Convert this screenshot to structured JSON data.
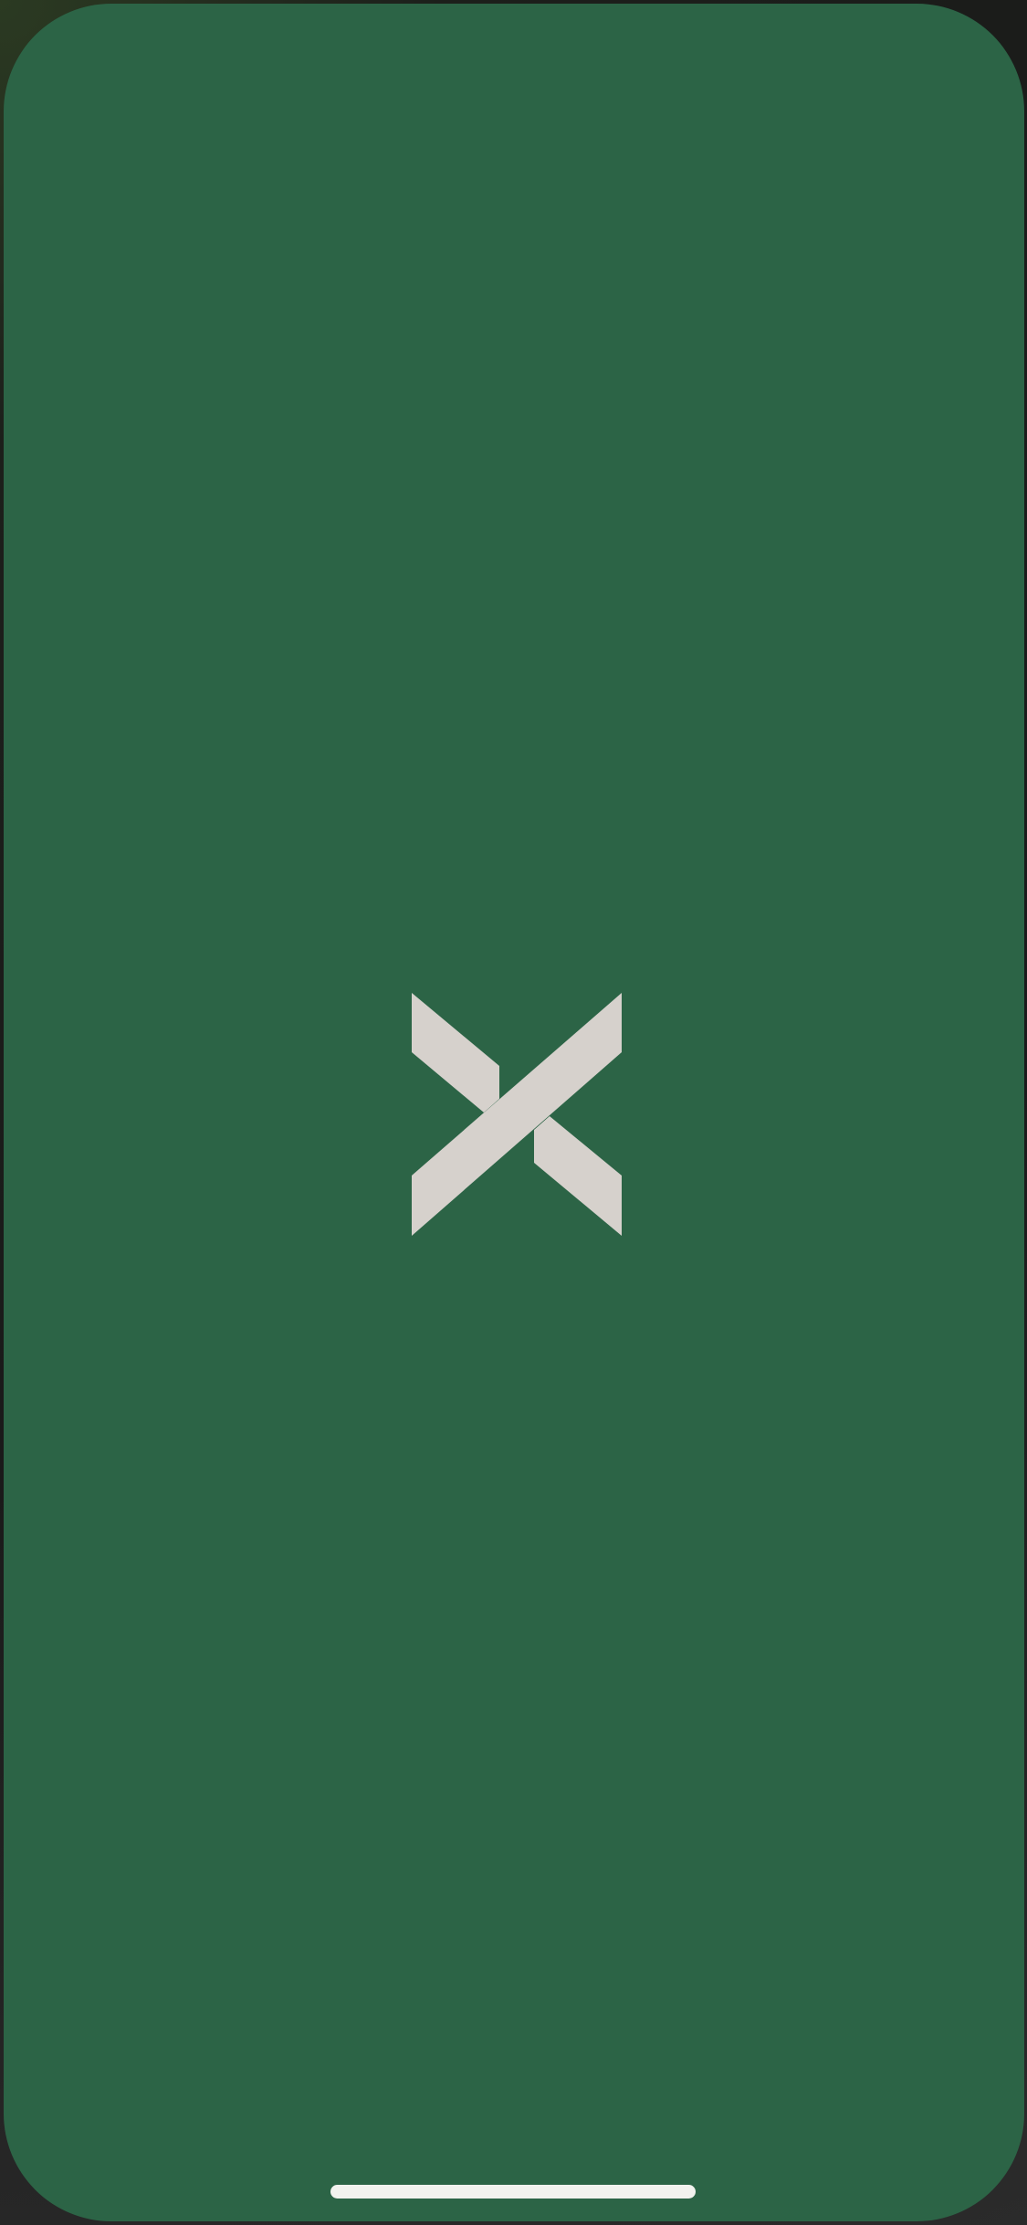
{
  "screen": {
    "type": "app-launch-splash",
    "background_color": "#2c6446"
  },
  "logo": {
    "icon": "x-logo-icon",
    "color": "#d6d1cc"
  },
  "home_indicator": {
    "color": "#f2f2ee"
  }
}
